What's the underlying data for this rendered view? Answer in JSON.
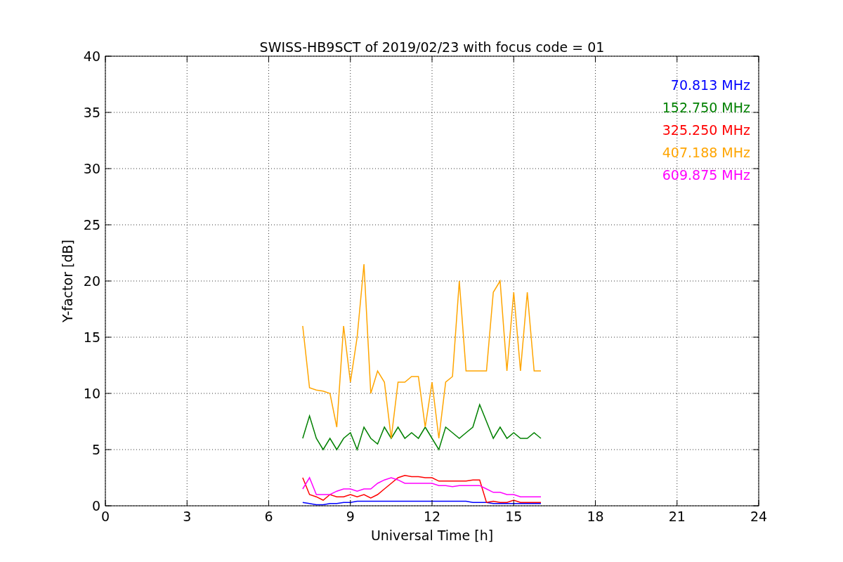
{
  "chart_data": {
    "type": "line",
    "title": "SWISS-HB9SCT of 2019/02/23 with focus code = 01",
    "xlabel": "Universal Time [h]",
    "ylabel": "Y-factor [dB]",
    "x": [
      7.25,
      7.5,
      7.75,
      8,
      8.25,
      8.5,
      8.75,
      9,
      9.25,
      9.5,
      9.75,
      10,
      10.25,
      10.5,
      10.75,
      11,
      11.25,
      11.5,
      11.75,
      12,
      12.25,
      12.5,
      12.75,
      13,
      13.25,
      13.5,
      13.75,
      14,
      14.25,
      14.5,
      14.75,
      15,
      15.25,
      15.5,
      15.75,
      16
    ],
    "series": [
      {
        "name": "70.813 MHz",
        "color": "#0000ff",
        "values": [
          0.3,
          0.2,
          0.1,
          0.1,
          0.2,
          0.2,
          0.3,
          0.3,
          0.4,
          0.4,
          0.4,
          0.4,
          0.4,
          0.4,
          0.4,
          0.4,
          0.4,
          0.4,
          0.4,
          0.4,
          0.4,
          0.4,
          0.4,
          0.4,
          0.4,
          0.3,
          0.3,
          0.3,
          0.2,
          0.2,
          0.2,
          0.2,
          0.2,
          0.2,
          0.2,
          0.2
        ]
      },
      {
        "name": "152.750 MHz",
        "color": "#008000",
        "values": [
          6,
          8,
          6,
          5,
          6,
          5,
          6,
          6.5,
          5,
          7,
          6,
          5.5,
          7,
          6,
          7,
          6,
          6.5,
          6,
          7,
          6,
          5,
          7,
          6.5,
          6,
          6.5,
          7,
          9,
          7.5,
          6,
          7,
          6,
          6.5,
          6,
          6,
          6.5,
          6
        ]
      },
      {
        "name": "325.250 MHz",
        "color": "#ff0000",
        "values": [
          2.5,
          1,
          0.8,
          0.5,
          1,
          0.8,
          0.8,
          1,
          0.8,
          1,
          0.7,
          1,
          1.5,
          2,
          2.5,
          2.7,
          2.6,
          2.6,
          2.5,
          2.5,
          2.2,
          2.2,
          2.2,
          2.2,
          2.2,
          2.3,
          2.3,
          0.3,
          0.4,
          0.3,
          0.3,
          0.5,
          0.3,
          0.3,
          0.3,
          0.3
        ]
      },
      {
        "name": "407.188 MHz",
        "color": "#ffa500",
        "values": [
          16,
          10.5,
          10.3,
          10.2,
          10,
          7,
          16,
          11,
          15,
          21.5,
          10,
          12,
          11,
          6,
          11,
          11,
          11.5,
          11.5,
          7,
          11,
          6,
          11,
          11.5,
          20,
          12,
          12,
          12,
          12,
          19,
          20,
          12,
          19,
          12,
          19,
          12,
          12
        ]
      },
      {
        "name": "609.875 MHz",
        "color": "#ff00ff",
        "values": [
          1.5,
          2.5,
          1,
          1,
          1,
          1.3,
          1.5,
          1.5,
          1.3,
          1.5,
          1.5,
          2,
          2.3,
          2.5,
          2.3,
          2,
          2,
          2,
          2,
          2,
          1.8,
          1.8,
          1.7,
          1.8,
          1.8,
          1.8,
          1.8,
          1.5,
          1.2,
          1.2,
          1,
          1,
          0.8,
          0.8,
          0.8,
          0.8
        ]
      }
    ],
    "grid": true,
    "xlim": [
      0,
      24
    ],
    "ylim": [
      0,
      40
    ],
    "xticks": [
      0,
      3,
      6,
      9,
      12,
      15,
      18,
      21,
      24
    ],
    "yticks": [
      0,
      5,
      10,
      15,
      20,
      25,
      30,
      35,
      40
    ]
  }
}
